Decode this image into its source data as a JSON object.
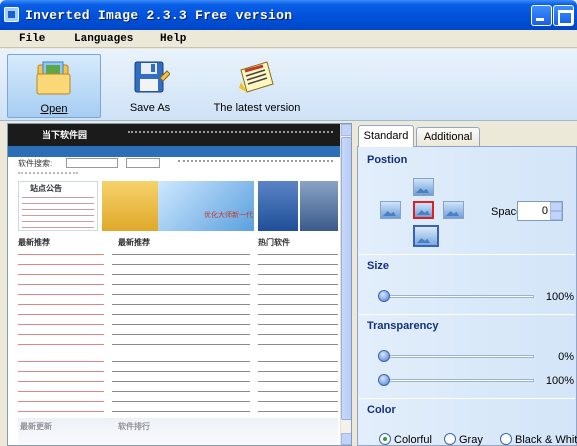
{
  "window": {
    "title": "Inverted Image 2.3.3 Free version"
  },
  "menu": {
    "file": "File",
    "languages": "Languages",
    "help": "Help"
  },
  "toolbar": {
    "open_label": "Open",
    "save_as_label": "Save As",
    "latest_label": "The latest version"
  },
  "panel": {
    "tabs": [
      "Standard",
      "Additional"
    ],
    "active_tab": "Standard",
    "position": {
      "title": "Postion",
      "selected": "center",
      "space_label": "Space",
      "space_value": "0"
    },
    "size": {
      "title": "Size",
      "value": "100%"
    },
    "transparency": {
      "title": "Transparency",
      "start_value": "0%",
      "end_value": "100%"
    },
    "color": {
      "title": "Color",
      "options": [
        "Colorful",
        "Gray",
        "Black & White"
      ],
      "selected": "Colorful"
    }
  },
  "preview": {
    "site_name": "当下软件园",
    "search_label": "软件搜索:",
    "section_titles": [
      "站点公告",
      "最新推荐",
      "热门软件",
      "最新更新",
      "软件排行"
    ],
    "banner_text": "优化大师新一代"
  },
  "colors": {
    "titlebar": "#0050d8",
    "accent": "#15317e",
    "preview_header": "#1b1b1b"
  }
}
